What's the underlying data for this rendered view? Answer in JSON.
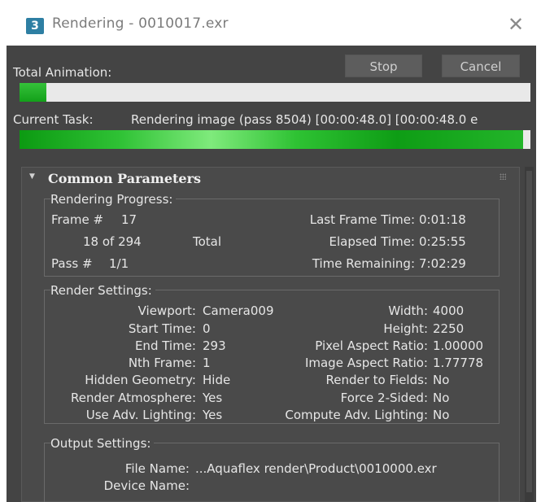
{
  "window": {
    "app_icon_text": "3",
    "title": "Rendering - 0010017.exr",
    "close_icon": "close-icon"
  },
  "total_animation": {
    "label": "Total Animation:",
    "progress": 0.052
  },
  "buttons": {
    "stop": "Stop",
    "cancel": "Cancel"
  },
  "current_task": {
    "label": "Current Task:",
    "value": "Rendering image (pass 8504) [00:00:48.0] [00:00:48.0 e",
    "progress": 0.985
  },
  "common_parameters": {
    "title": "Common Parameters",
    "rendering_progress": {
      "label": "Rendering Progress:",
      "frame_label": "Frame #",
      "frame_value": "17",
      "of_text": "18 of 294",
      "total_label": "Total",
      "pass_label": "Pass #",
      "pass_value": "1/1",
      "last_frame_time_label": "Last Frame Time:",
      "last_frame_time": "0:01:18",
      "elapsed_time_label": "Elapsed Time:",
      "elapsed_time": "0:25:55",
      "time_remaining_label": "Time Remaining:",
      "time_remaining": "7:02:29"
    },
    "render_settings": {
      "label": "Render Settings:",
      "left": [
        {
          "label": "Viewport:",
          "value": "Camera009"
        },
        {
          "label": "Start Time:",
          "value": "0"
        },
        {
          "label": "End Time:",
          "value": "293"
        },
        {
          "label": "Nth Frame:",
          "value": "1"
        },
        {
          "label": "Hidden Geometry:",
          "value": "Hide"
        },
        {
          "label": "Render Atmosphere:",
          "value": "Yes"
        },
        {
          "label": "Use Adv. Lighting:",
          "value": "Yes"
        }
      ],
      "right": [
        {
          "label": "Width:",
          "value": "4000"
        },
        {
          "label": "Height:",
          "value": "2250"
        },
        {
          "label": "Pixel Aspect Ratio:",
          "value": "1.00000"
        },
        {
          "label": "Image Aspect Ratio:",
          "value": "1.77778"
        },
        {
          "label": "Render to Fields:",
          "value": "No"
        },
        {
          "label": "Force 2-Sided:",
          "value": "No"
        },
        {
          "label": "Compute Adv. Lighting:",
          "value": "No"
        }
      ]
    },
    "output_settings": {
      "label": "Output Settings:",
      "file_name_label": "File Name:",
      "file_name": "...Aquaflex render\\Product\\0010000.exr",
      "device_name_label": "Device Name:",
      "device_name": ""
    }
  },
  "colors": {
    "panel_bg": "#444444",
    "progress_green": "#22b12a",
    "track": "#e9e9e9"
  }
}
